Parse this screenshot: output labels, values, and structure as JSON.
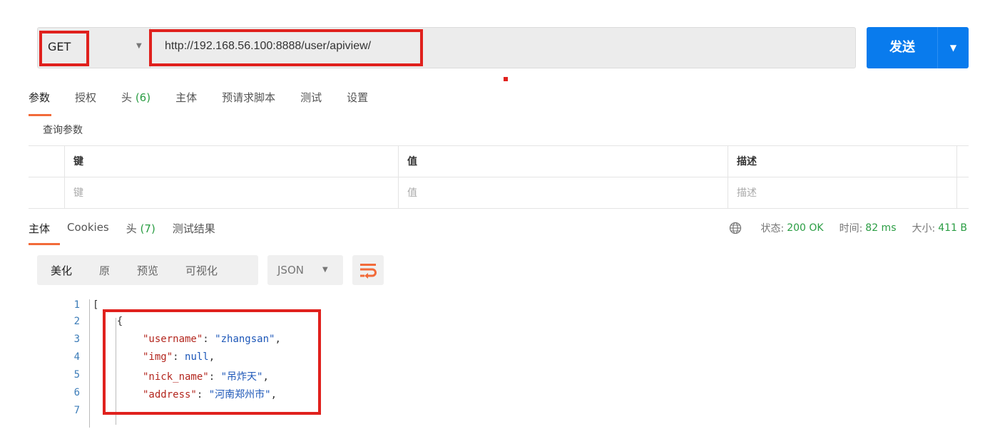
{
  "request": {
    "method": "GET",
    "url": "http://192.168.56.100:8888/user/apiview/",
    "send_label": "发送"
  },
  "request_tabs": [
    {
      "label": "参数",
      "count": ""
    },
    {
      "label": "授权",
      "count": ""
    },
    {
      "label": "头",
      "count": "(6)"
    },
    {
      "label": "主体",
      "count": ""
    },
    {
      "label": "预请求脚本",
      "count": ""
    },
    {
      "label": "测试",
      "count": ""
    },
    {
      "label": "设置",
      "count": ""
    }
  ],
  "query_params": {
    "section_label": "查询参数",
    "headers": [
      "键",
      "值",
      "描述"
    ],
    "placeholders": [
      "键",
      "值",
      "描述"
    ]
  },
  "response_tabs": [
    {
      "label": "主体",
      "count": ""
    },
    {
      "label": "Cookies",
      "count": ""
    },
    {
      "label": "头",
      "count": "(7)"
    },
    {
      "label": "测试结果",
      "count": ""
    }
  ],
  "status": {
    "status_label": "状态:",
    "status_value": "200 OK",
    "time_label": "时间:",
    "time_value": "82 ms",
    "size_label": "大小:",
    "size_value": "411 B"
  },
  "view_modes": [
    "美化",
    "原",
    "预览",
    "可视化"
  ],
  "format": "JSON",
  "code_lines": [
    {
      "n": "1",
      "text": "["
    },
    {
      "n": "2",
      "text": "    {"
    },
    {
      "n": "3",
      "key": "\"username\"",
      "sep": ": ",
      "val": "\"zhangsan\"",
      "end": ","
    },
    {
      "n": "4",
      "key": "\"img\"",
      "sep": ": ",
      "val": "null",
      "end": ","
    },
    {
      "n": "5",
      "key": "\"nick_name\"",
      "sep": ": ",
      "val": "\"吊炸天\"",
      "end": ","
    },
    {
      "n": "6",
      "key": "\"address\"",
      "sep": ": ",
      "val": "\"河南郑州市\"",
      "end": ","
    },
    {
      "n": "7",
      "text": ""
    }
  ],
  "colors": {
    "accent": "#f26b3a",
    "send": "#097bed",
    "highlight": "#e0211d",
    "status_ok": "#2a9d43"
  }
}
